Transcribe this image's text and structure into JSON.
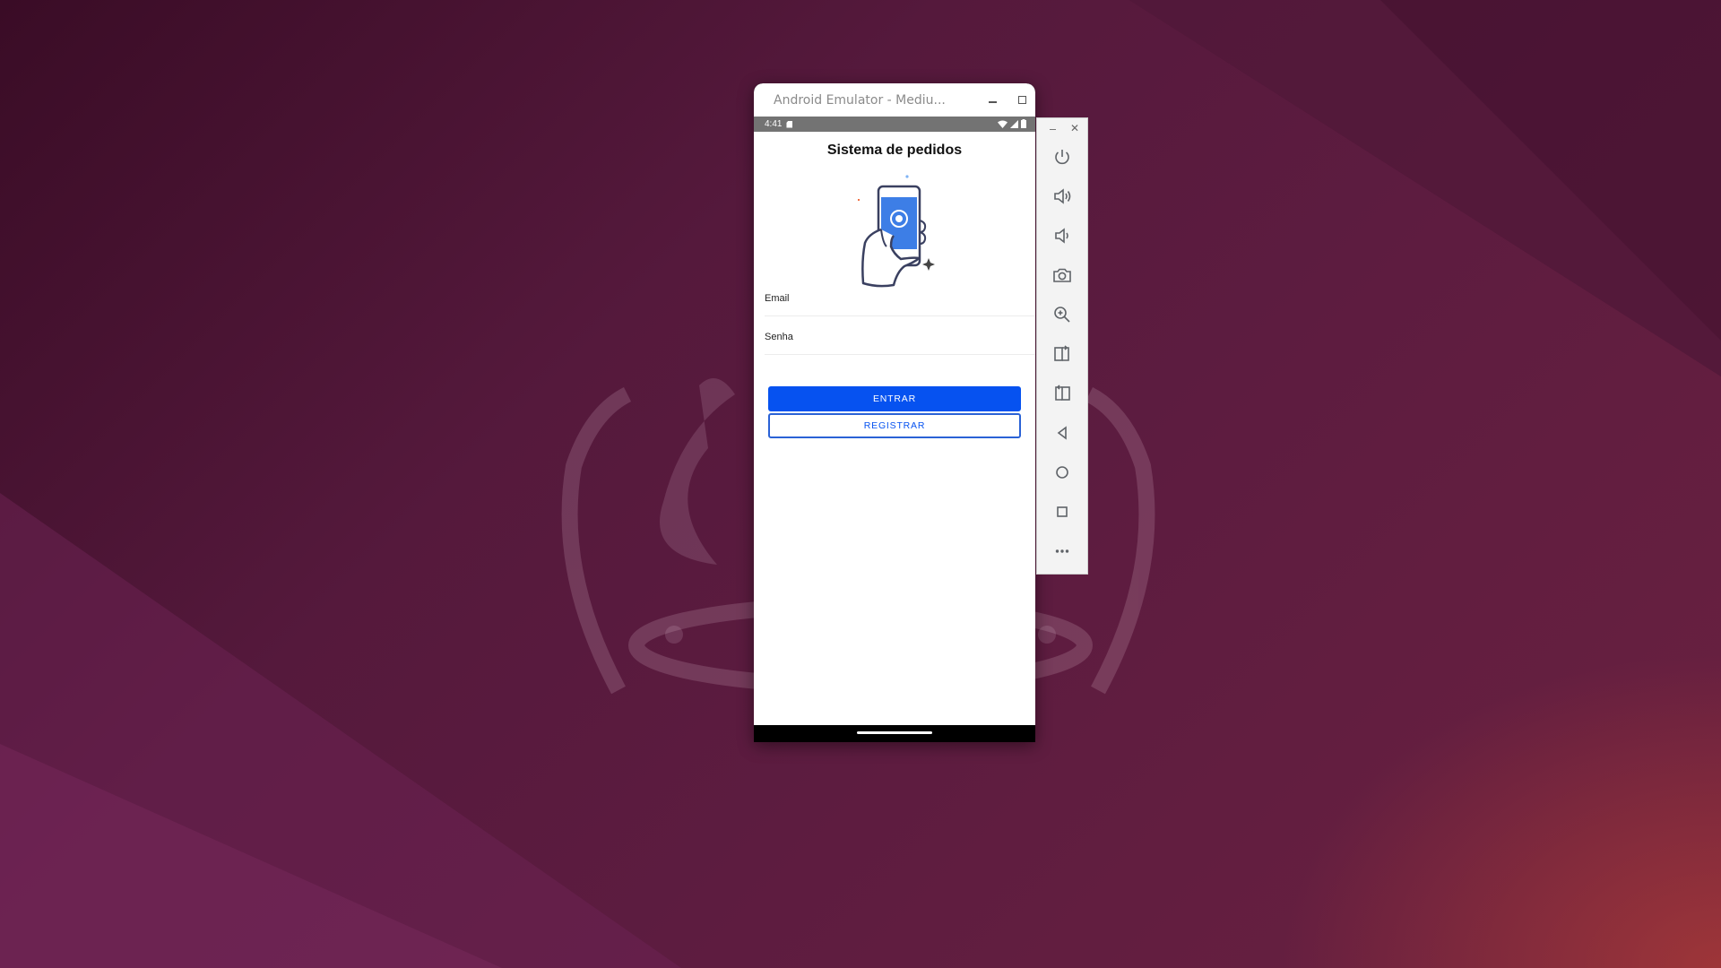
{
  "emulator": {
    "title": "Android Emulator - Mediu...",
    "status": {
      "time": "4:41"
    },
    "app": {
      "title": "Sistema de pedidos",
      "fields": {
        "email_label": "Email",
        "password_label": "Senha"
      },
      "buttons": {
        "login": "ENTRAR",
        "register": "REGISTRAR"
      }
    }
  },
  "toolbar": {
    "items": [
      "power-icon",
      "volume-up-icon",
      "volume-down-icon",
      "camera-icon",
      "zoom-icon",
      "rotate-left-icon",
      "rotate-right-icon",
      "back-icon",
      "home-icon",
      "overview-icon",
      "more-icon"
    ]
  },
  "colors": {
    "primary": "#0652f0",
    "statusbar": "#737373",
    "wallpaper_dark": "#3a0c26",
    "wallpaper_accent": "#c84632"
  }
}
